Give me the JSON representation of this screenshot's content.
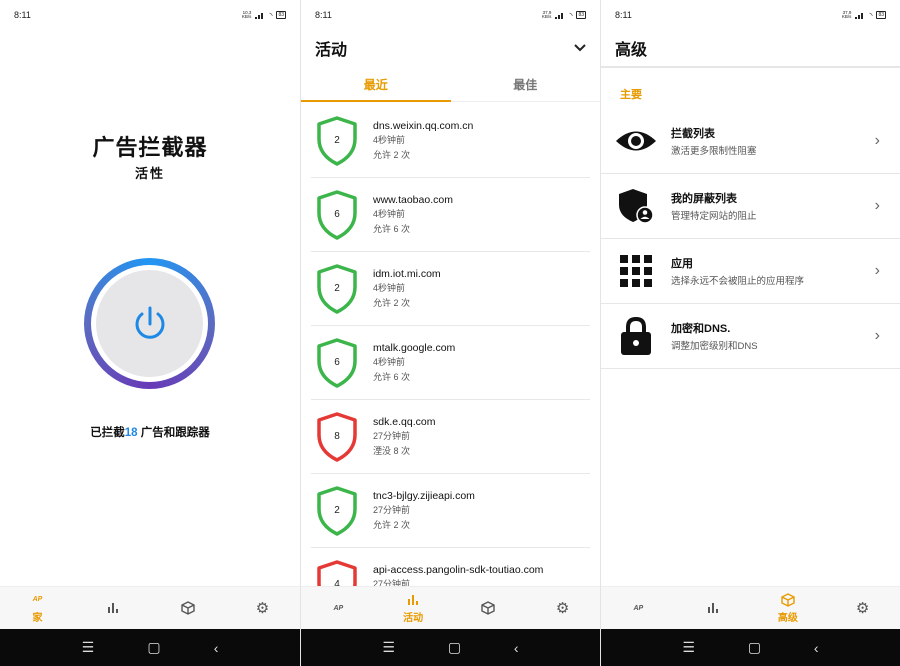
{
  "status_bar": {
    "time": "8:11",
    "network_speed_screen1": "10.3 KB/s",
    "network_speed_screen2": "37.9 KB/s",
    "network_speed_screen3": "37.9 KB/s",
    "battery": "83"
  },
  "home": {
    "title": "广告拦截器",
    "status": "活性",
    "blocked_prefix": "已拦截",
    "blocked_count": "18",
    "blocked_suffix": " 广告和跟踪器"
  },
  "activity": {
    "title": "活动",
    "tabs": [
      "最近",
      "最佳"
    ],
    "items": [
      {
        "count": "2",
        "domain": "dns.weixin.qq.com.cn",
        "time": "4秒钟前",
        "detail": "允许 2 次",
        "status": "allowed"
      },
      {
        "count": "6",
        "domain": "www.taobao.com",
        "time": "4秒钟前",
        "detail": "允许 6 次",
        "status": "allowed"
      },
      {
        "count": "2",
        "domain": "idm.iot.mi.com",
        "time": "4秒钟前",
        "detail": "允许 2 次",
        "status": "allowed"
      },
      {
        "count": "6",
        "domain": "mtalk.google.com",
        "time": "4秒钟前",
        "detail": "允许 6 次",
        "status": "allowed"
      },
      {
        "count": "8",
        "domain": "sdk.e.qq.com",
        "time": "27分钟前",
        "detail": "湮没 8 次",
        "status": "blocked"
      },
      {
        "count": "2",
        "domain": "tnc3-bjlgy.zijieapi.com",
        "time": "27分钟前",
        "detail": "允许 2 次",
        "status": "allowed"
      },
      {
        "count": "4",
        "domain": "api-access.pangolin-sdk-toutiao.com",
        "time": "27分钟前",
        "detail": "",
        "status": "blocked"
      }
    ]
  },
  "advanced": {
    "title": "高级",
    "section": "主要",
    "items": [
      {
        "title": "拦截列表",
        "subtitle": "激活更多限制性阻塞",
        "icon": "eye-icon"
      },
      {
        "title": "我的屏蔽列表",
        "subtitle": "管理特定网站的阻止",
        "icon": "shield-user-icon"
      },
      {
        "title": "应用",
        "subtitle": "选择永远不会被阻止的应用程序",
        "icon": "grid-icon"
      },
      {
        "title": "加密和DNS.",
        "subtitle": "调整加密级别和DNS",
        "icon": "lock-icon"
      }
    ]
  },
  "bottom_nav": {
    "home_label": "家",
    "activity_label": "活动",
    "advanced_label": "高级",
    "icons": [
      "adblock-logo-icon",
      "bar-chart-icon",
      "cube-icon",
      "gear-icon"
    ]
  },
  "colors": {
    "accent": "#e89a00",
    "allowed": "#3cb54a",
    "blocked": "#e53935",
    "count_blue": "#1e88e5"
  }
}
